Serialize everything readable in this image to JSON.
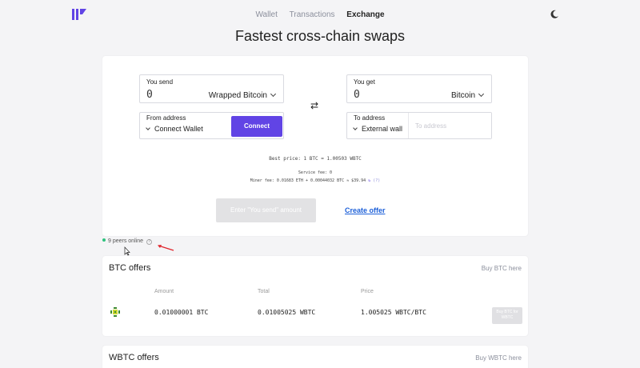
{
  "nav": {
    "items": [
      "Wallet",
      "Transactions",
      "Exchange"
    ],
    "active": "Exchange"
  },
  "headline": "Fastest cross-chain swaps",
  "swap": {
    "send": {
      "label": "You send",
      "amount": "0",
      "currency": "Wrapped Bitcoin"
    },
    "get": {
      "label": "You get",
      "amount": "0",
      "currency": "Bitcoin"
    },
    "from_address": {
      "label": "From address",
      "option": "Connect Wallet",
      "button": "Connect"
    },
    "to_address": {
      "label": "To address",
      "option": "External wall",
      "placeholder": "To address"
    },
    "best_price": "Best price: 1 BTC = 1.00503 WBTC",
    "service_fee": "Service fee: 0",
    "miner_fee": "Miner fee: 0.01683 ETH + 0.00044032 BTC ≈ $39.94",
    "miner_fee_help": "(?)",
    "submit_button": "Enter \"You send\" amount",
    "create_offer": "Create offer"
  },
  "peers": {
    "text": "9 peers online",
    "status_color": "#2ec27e"
  },
  "btc_offers": {
    "title": "BTC offers",
    "link": "Buy BTC here",
    "columns": [
      "Amount",
      "Total",
      "Price"
    ],
    "rows": [
      {
        "amount": "0.01000001 BTC",
        "total": "0.01005025 WBTC",
        "price": "1.005025 WBTC/BTC",
        "button": "Buy BTC for WBTC"
      }
    ]
  },
  "wbtc_offers": {
    "title": "WBTC offers",
    "link": "Buy WBTC here"
  },
  "colors": {
    "accent": "#6144e5",
    "link": "#1c5fd8"
  }
}
